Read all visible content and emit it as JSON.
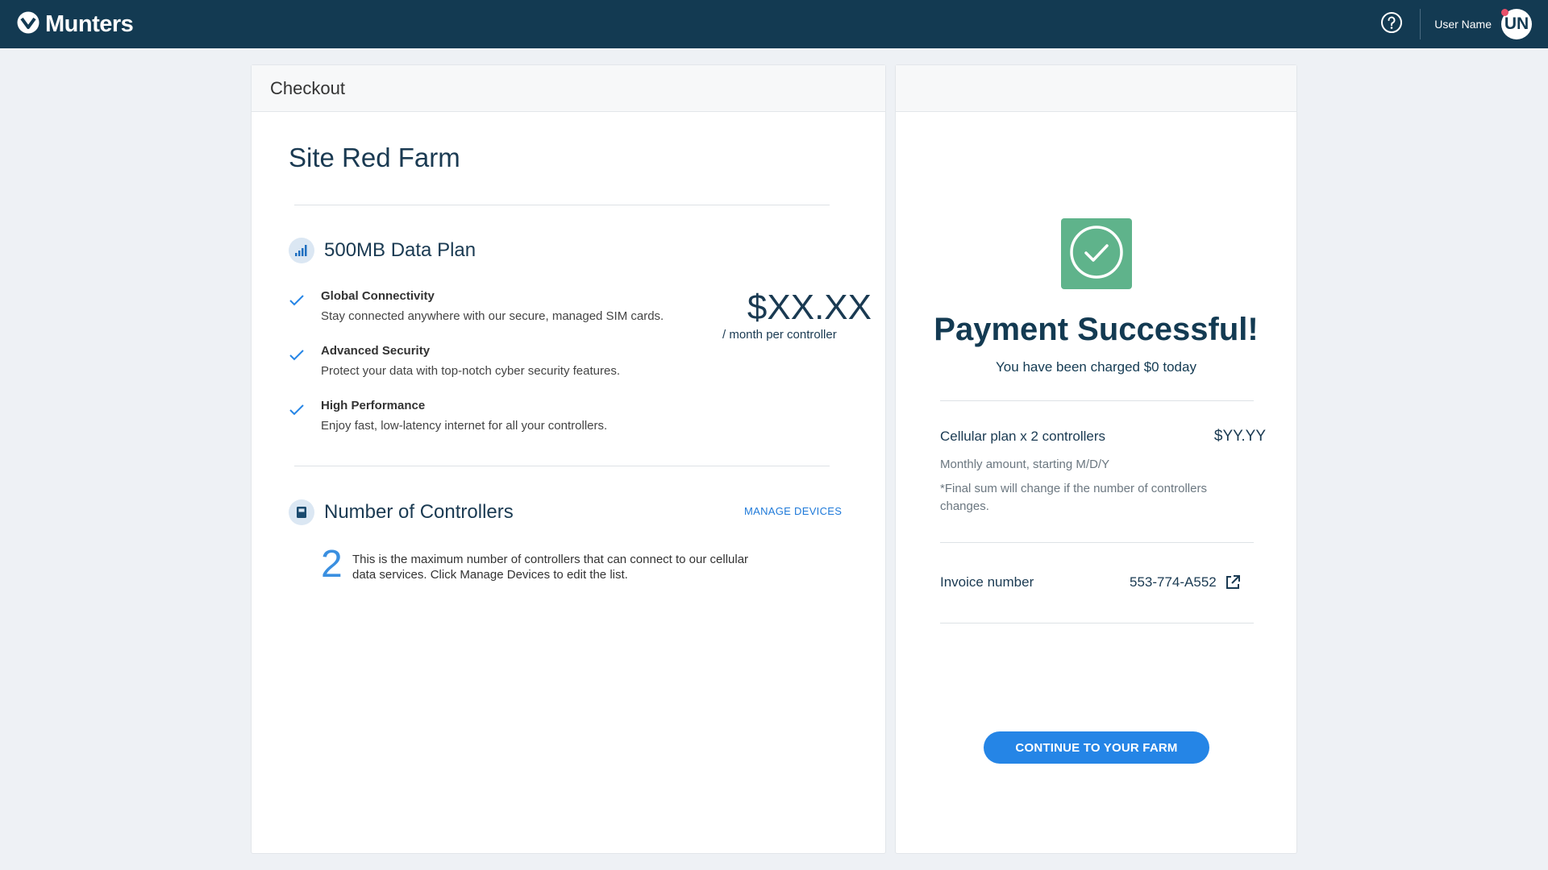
{
  "header": {
    "brand": "Munters",
    "user_name": "User Name",
    "avatar_initials": "UN"
  },
  "checkout": {
    "title": "Checkout",
    "site_title": "Site Red Farm",
    "plan": {
      "title": "500MB Data Plan",
      "price": "$XX.XX",
      "price_unit": "/ month per controller",
      "features": [
        {
          "title": "Global Connectivity",
          "desc": "Stay connected anywhere with our secure, managed SIM cards."
        },
        {
          "title": "Advanced Security",
          "desc": "Protect your data with top-notch cyber security features."
        },
        {
          "title": "High Performance",
          "desc": "Enjoy fast, low-latency internet for all your controllers."
        }
      ]
    },
    "controllers": {
      "title": "Number of Controllers",
      "manage_label": "MANAGE DEVICES",
      "count": "2",
      "desc": "This is the maximum number of controllers that can connect to our cellular data services. Click Manage Devices to edit the list."
    }
  },
  "summary": {
    "title": "Payment Successful!",
    "subtitle": "You have been charged $0 today",
    "plan_label": "Cellular plan x 2 controllers",
    "plan_value": "$YY.YY",
    "monthly_note": "Monthly amount, starting M/D/Y",
    "final_note": "*Final sum will change if the number of controllers changes.",
    "invoice_label": "Invoice number",
    "invoice_number": "553-774-A552",
    "continue_label": "CONTINUE TO YOUR FARM"
  },
  "colors": {
    "topbar": "#133a52",
    "accent": "#2585e6",
    "success": "#5fb38b"
  }
}
